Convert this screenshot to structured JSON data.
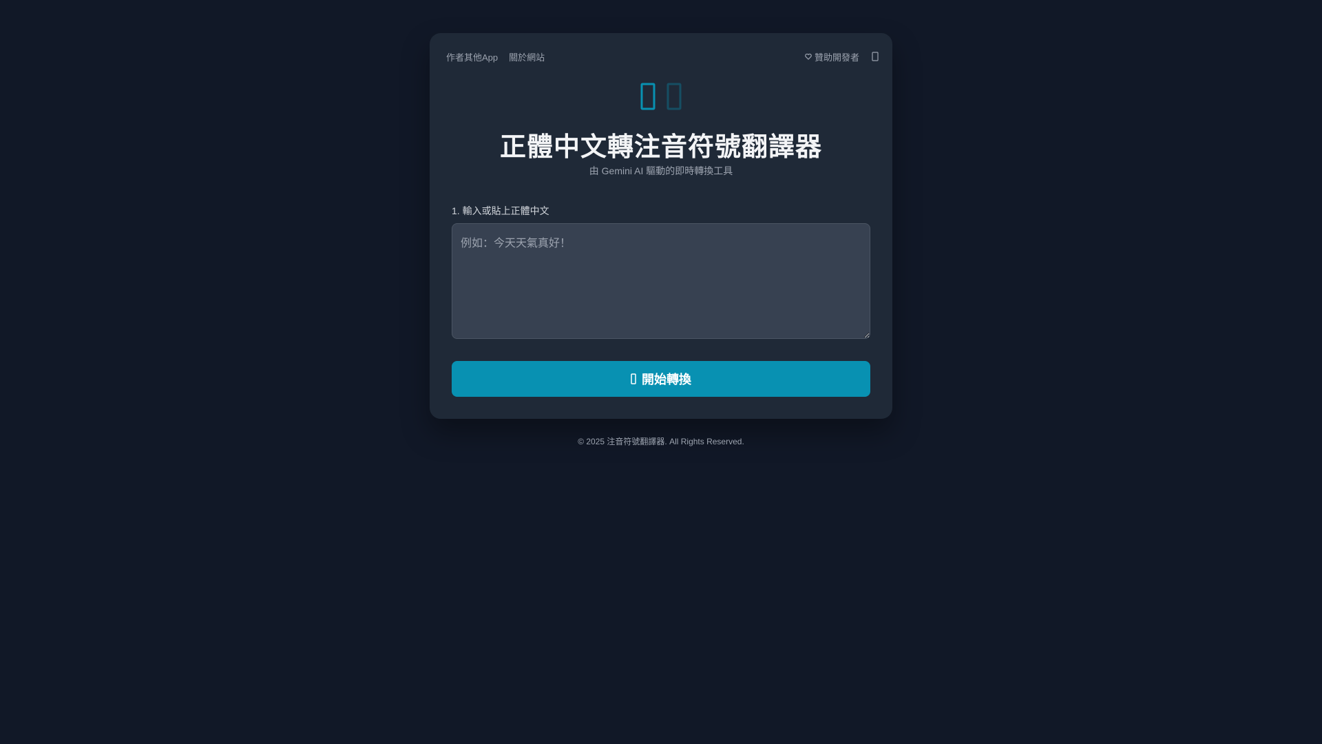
{
  "nav": {
    "links": [
      "作者其他App",
      "關於網站"
    ],
    "sponsor_label": "贊助開發者"
  },
  "header": {
    "title": "正體中文轉注音符號翻譯器",
    "subtitle": "由 Gemini AI 驅動的即時轉換工具"
  },
  "input": {
    "label": "1. 輸入或貼上正體中文",
    "value": "",
    "placeholder": "例如：今天天氣真好！"
  },
  "convert_button": {
    "label": "開始轉換"
  },
  "footer": {
    "copyright": "© 2025 注音符號翻譯器. All Rights Reserved."
  },
  "colors": {
    "background": "#111827",
    "card": "#1f2937",
    "accent": "#0891b2",
    "logo_primary": "#0891b2",
    "logo_secondary": "#164e63"
  },
  "icons": {
    "logo": [
      "logo-icon-primary",
      "logo-icon-secondary"
    ],
    "sponsor": "heart-icon",
    "settings": "settings-icon",
    "button": "convert-icon"
  }
}
